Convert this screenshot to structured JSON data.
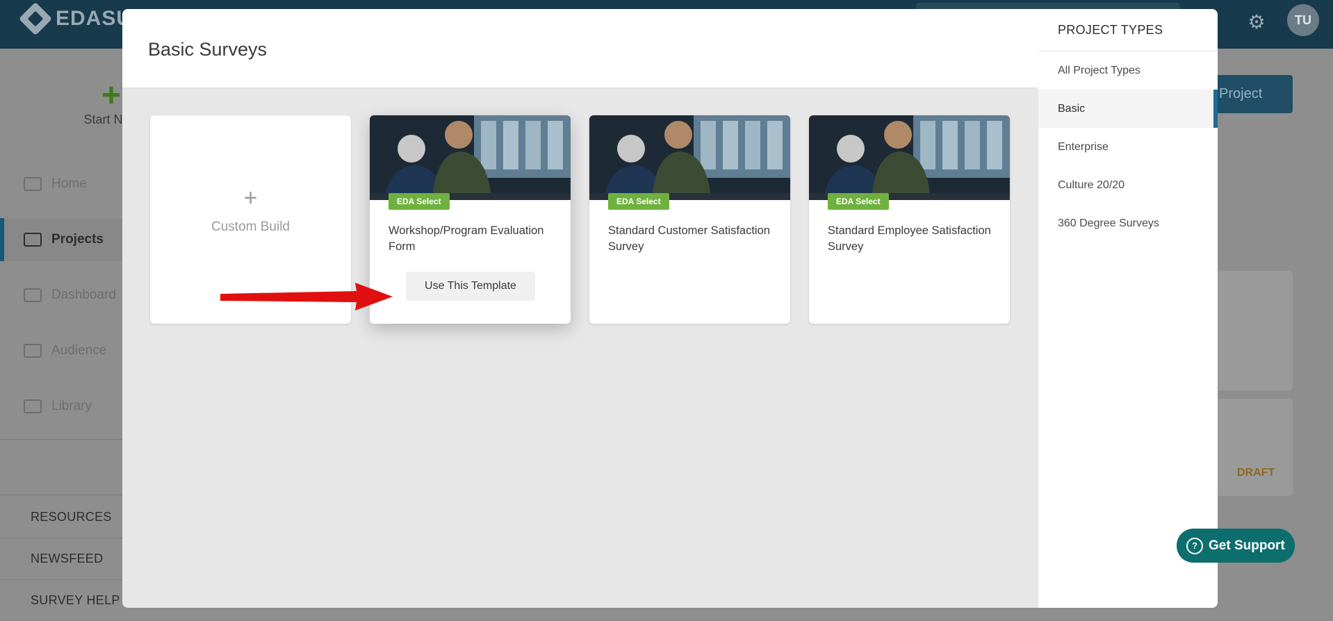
{
  "app": {
    "logo_text": "EDASU",
    "avatar_initials": "TU"
  },
  "sidebar": {
    "start_new_label": "Start New",
    "items": [
      {
        "label": "Home",
        "icon": "home-icon"
      },
      {
        "label": "Projects",
        "icon": "folder-icon"
      },
      {
        "label": "Dashboard",
        "icon": "chart-icon"
      },
      {
        "label": "Audience",
        "icon": "people-icon"
      },
      {
        "label": "Library",
        "icon": "books-icon"
      }
    ],
    "links": [
      "RESOURCES",
      "NEWSFEED",
      "SURVEY HELP"
    ]
  },
  "background": {
    "new_project_label": "w Project",
    "draft_label": "DRAFT"
  },
  "modal": {
    "title": "Basic Surveys",
    "custom_build": {
      "plus": "+",
      "label": "Custom Build"
    },
    "templates": [
      {
        "badge": "EDA Select",
        "title": "Workshop/Program Evaluation Form",
        "button": "Use This Template"
      },
      {
        "badge": "EDA Select",
        "title": "Standard Customer Satisfaction Survey"
      },
      {
        "badge": "EDA Select",
        "title": "Standard Employee Satisfaction Survey"
      }
    ],
    "project_types": {
      "heading": "PROJECT TYPES",
      "items": [
        "All Project Types",
        "Basic",
        "Enterprise",
        "Culture 20/20",
        "360 Degree Surveys"
      ],
      "selected": "Basic"
    }
  },
  "support": {
    "label": "Get Support",
    "icon": "question-icon"
  },
  "colors": {
    "accent": "#1a6e96",
    "badge": "#6fb13f",
    "support": "#0d6e6e",
    "arrow": "#e01010"
  }
}
